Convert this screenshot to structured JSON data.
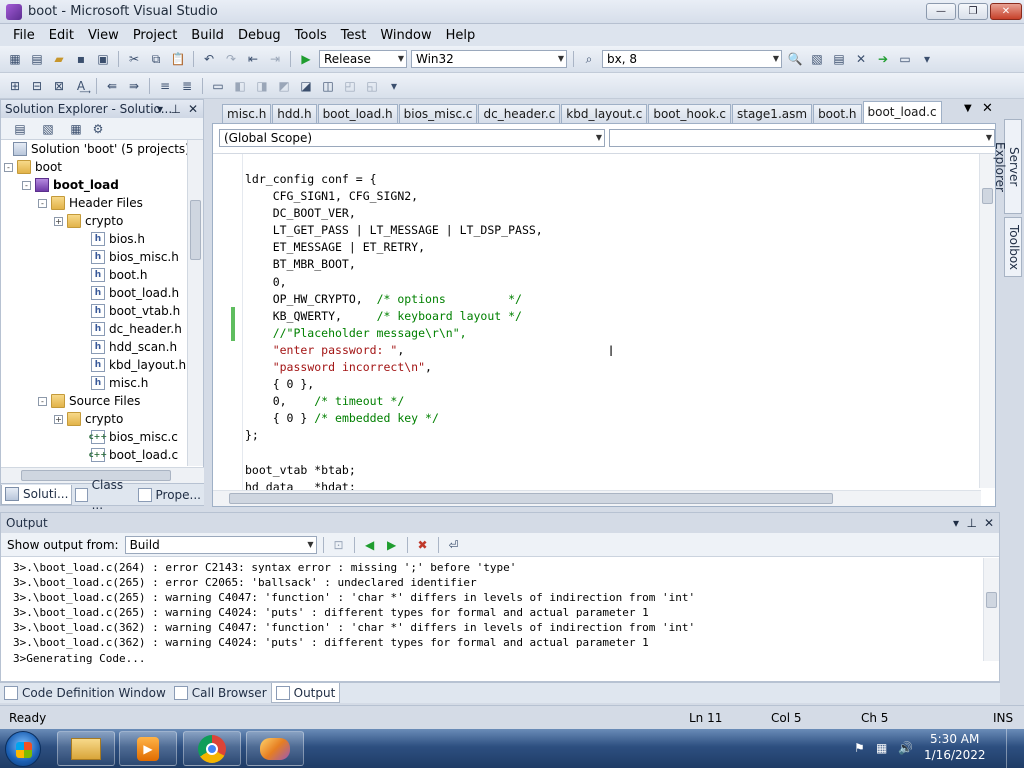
{
  "window": {
    "title": "boot - Microsoft Visual Studio"
  },
  "menu": [
    "File",
    "Edit",
    "View",
    "Project",
    "Build",
    "Debug",
    "Tools",
    "Test",
    "Window",
    "Help"
  ],
  "toolbar": {
    "config": "Release",
    "platform": "Win32",
    "find": "bx, 8"
  },
  "solution_explorer": {
    "header": "Solution Explorer - Solutio...",
    "tree": [
      {
        "label": "Solution 'boot' (5 projects)",
        "icon": "solution",
        "level": 0,
        "expander": ""
      },
      {
        "label": "boot",
        "icon": "folder",
        "level": 1,
        "expander": "-"
      },
      {
        "label": "boot_load",
        "icon": "project",
        "level": 2,
        "expander": "-",
        "bold": true
      },
      {
        "label": "Header Files",
        "icon": "folder",
        "level": 3,
        "expander": "-"
      },
      {
        "label": "crypto",
        "icon": "folder",
        "level": 4,
        "expander": "+"
      },
      {
        "label": "bios.h",
        "icon": "h",
        "level": 5
      },
      {
        "label": "bios_misc.h",
        "icon": "h",
        "level": 5
      },
      {
        "label": "boot.h",
        "icon": "h",
        "level": 5
      },
      {
        "label": "boot_load.h",
        "icon": "h",
        "level": 5
      },
      {
        "label": "boot_vtab.h",
        "icon": "h",
        "level": 5
      },
      {
        "label": "dc_header.h",
        "icon": "h",
        "level": 5
      },
      {
        "label": "hdd_scan.h",
        "icon": "h",
        "level": 5
      },
      {
        "label": "kbd_layout.h",
        "icon": "h",
        "level": 5
      },
      {
        "label": "misc.h",
        "icon": "h",
        "level": 5
      },
      {
        "label": "Source Files",
        "icon": "folder",
        "level": 3,
        "expander": "-"
      },
      {
        "label": "crypto",
        "icon": "folder",
        "level": 4,
        "expander": "+"
      },
      {
        "label": "bios_misc.c",
        "icon": "c",
        "level": 5
      },
      {
        "label": "boot_load.c",
        "icon": "c",
        "level": 5
      }
    ],
    "tabs": [
      "Soluti...",
      "Class ...",
      "Prope..."
    ]
  },
  "editor": {
    "tabs": [
      "misc.h",
      "hdd.h",
      "boot_load.h",
      "bios_misc.c",
      "dc_header.c",
      "kbd_layout.c",
      "boot_hook.c",
      "stage1.asm",
      "boot.h",
      "boot_load.c"
    ],
    "active_tab": "boot_load.c",
    "scope": "(Global Scope)",
    "code": [
      [
        {
          "t": "ldr_config conf = {",
          "c": ""
        }
      ],
      [
        {
          "t": "    CFG_SIGN1, CFG_SIGN2,",
          "c": ""
        }
      ],
      [
        {
          "t": "    DC_BOOT_VER,",
          "c": ""
        }
      ],
      [
        {
          "t": "    LT_GET_PASS | LT_MESSAGE | LT_DSP_PASS,",
          "c": ""
        }
      ],
      [
        {
          "t": "    ET_MESSAGE | ET_RETRY,",
          "c": ""
        }
      ],
      [
        {
          "t": "    BT_MBR_BOOT,",
          "c": ""
        }
      ],
      [
        {
          "t": "    0,",
          "c": ""
        }
      ],
      [
        {
          "t": "    OP_HW_CRYPTO,  ",
          "c": ""
        },
        {
          "t": "/* options         */",
          "c": "cm"
        }
      ],
      [
        {
          "t": "    KB_QWERTY,     ",
          "c": ""
        },
        {
          "t": "/* keyboard layout */",
          "c": "cm"
        }
      ],
      [
        {
          "t": "    //\"Placeholder message\\r\\n\",",
          "c": "cm"
        }
      ],
      [
        {
          "t": "    ",
          "c": ""
        },
        {
          "t": "\"enter password: \"",
          "c": "st"
        },
        {
          "t": ",",
          "c": ""
        }
      ],
      [
        {
          "t": "    ",
          "c": ""
        },
        {
          "t": "\"password incorrect\\n\"",
          "c": "st"
        },
        {
          "t": ",",
          "c": ""
        }
      ],
      [
        {
          "t": "    { 0 },",
          "c": ""
        }
      ],
      [
        {
          "t": "    0,    ",
          "c": ""
        },
        {
          "t": "/* timeout */",
          "c": "cm"
        }
      ],
      [
        {
          "t": "    { 0 } ",
          "c": ""
        },
        {
          "t": "/* embedded key */",
          "c": "cm"
        }
      ],
      [
        {
          "t": "};",
          "c": ""
        }
      ],
      [
        {
          "t": "",
          "c": ""
        }
      ],
      [
        {
          "t": "boot_vtab *btab;",
          "c": ""
        }
      ],
      [
        {
          "t": "hd_data   *hdat;",
          "c": ""
        }
      ]
    ]
  },
  "right_strip": {
    "tabs": [
      "Server Explorer",
      "Toolbox"
    ]
  },
  "output": {
    "header": "Output",
    "show_from_label": "Show output from:",
    "source": "Build",
    "lines": [
      "3>.\\boot_load.c(264) : error C2143: syntax error : missing ';' before 'type'",
      "3>.\\boot_load.c(265) : error C2065: 'ballsack' : undeclared identifier",
      "3>.\\boot_load.c(265) : warning C4047: 'function' : 'char *' differs in levels of indirection from 'int'",
      "3>.\\boot_load.c(265) : warning C4024: 'puts' : different types for formal and actual parameter 1",
      "3>.\\boot_load.c(362) : warning C4047: 'function' : 'char *' differs in levels of indirection from 'int'",
      "3>.\\boot_load.c(362) : warning C4024: 'puts' : different types for formal and actual parameter 1",
      "3>Generating Code..."
    ],
    "tabs": [
      "Code Definition Window",
      "Call Browser",
      "Output"
    ]
  },
  "status": {
    "ready": "Ready",
    "ln": "Ln 11",
    "col": "Col 5",
    "ch": "Ch 5",
    "mode": "INS"
  },
  "taskbar": {
    "time": "5:30 AM",
    "date": "1/16/2022"
  },
  "colors": {
    "comment": "#008000",
    "string": "#a31515",
    "accent": "#2d4f80"
  }
}
